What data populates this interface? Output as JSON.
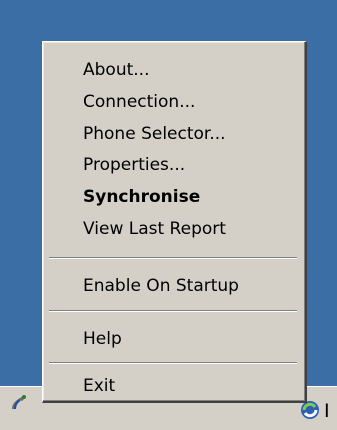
{
  "menu": {
    "items": [
      {
        "label": "About..."
      },
      {
        "label": "Connection..."
      },
      {
        "label": "Phone Selector..."
      },
      {
        "label": "Properties..."
      },
      {
        "label": "Synchronise"
      },
      {
        "label": "View Last Report"
      },
      {
        "label": "Enable On Startup"
      },
      {
        "label": "Help"
      },
      {
        "label": "Exit"
      }
    ]
  },
  "taskbar": {
    "partial_text": "I",
    "icons": [
      "phone-tray-icon",
      "sync-tray-icon"
    ]
  },
  "colors": {
    "desktop": "#3a6ea5",
    "menu_background": "#d4d0c8"
  }
}
